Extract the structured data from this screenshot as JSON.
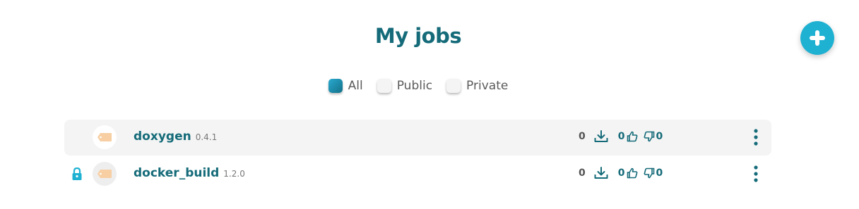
{
  "page": {
    "title": "My jobs"
  },
  "add_button": {
    "icon": "plus-icon",
    "color": "#1fb1d2"
  },
  "filters": [
    {
      "label": "All",
      "checked": true
    },
    {
      "label": "Public",
      "checked": false
    },
    {
      "label": "Private",
      "checked": false
    }
  ],
  "jobs": [
    {
      "name": "doxygen",
      "version": "0.4.1",
      "private": false,
      "downloads": "0",
      "likes": "0",
      "dislikes": "0"
    },
    {
      "name": "docker_build",
      "version": "1.2.0",
      "private": true,
      "downloads": "0",
      "likes": "0",
      "dislikes": "0"
    }
  ],
  "colors": {
    "accent": "#156b79",
    "add_button": "#1fb1d2",
    "row_highlight": "#f4f4f4",
    "tag": "#f7cfa3"
  }
}
